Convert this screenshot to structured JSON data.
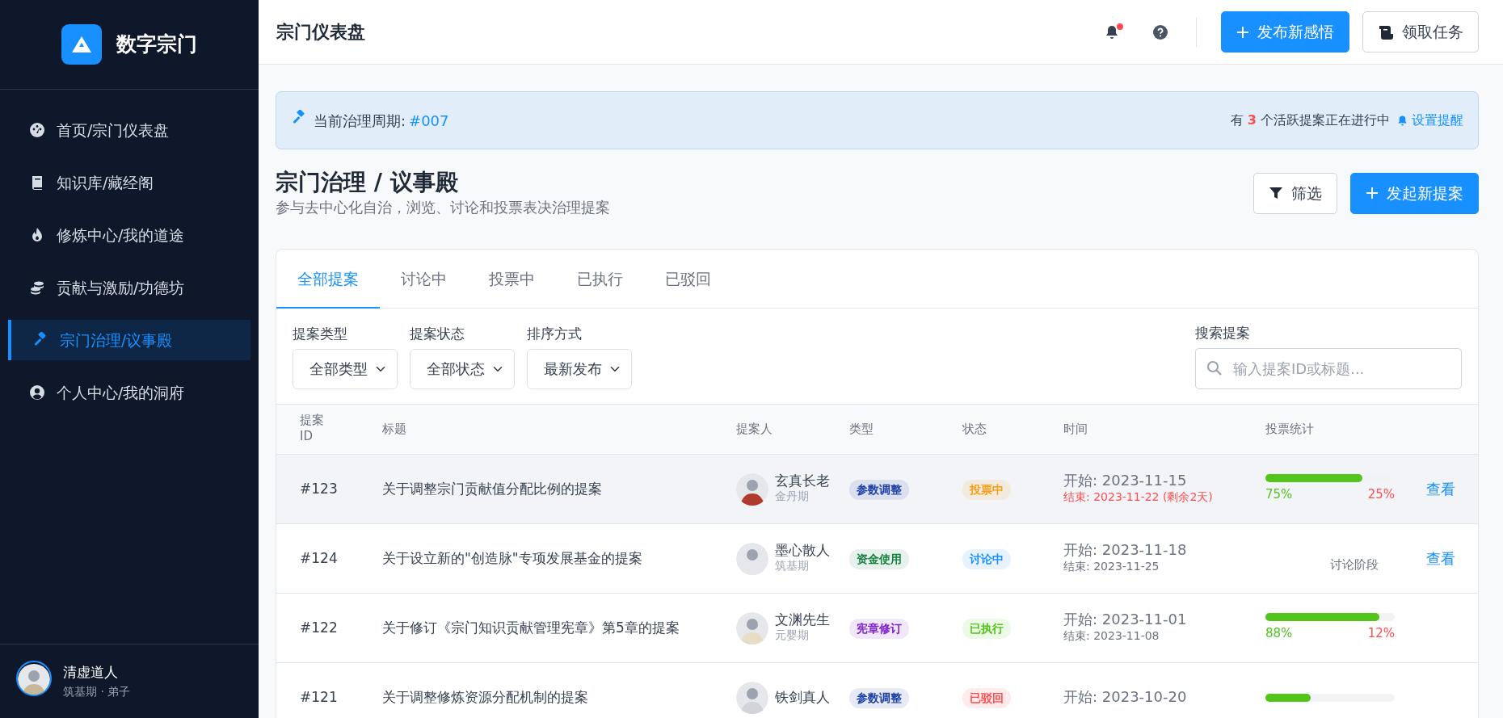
{
  "sidebar": {
    "brand": "数字宗门",
    "items": [
      {
        "label": "首页/宗门仪表盘",
        "selected": false
      },
      {
        "label": "知识库/藏经阁",
        "selected": false
      },
      {
        "label": "修炼中心/我的道途",
        "selected": false
      },
      {
        "label": "贡献与激励/功德坊",
        "selected": false
      },
      {
        "label": "宗门治理/议事殿",
        "selected": true
      },
      {
        "label": "个人中心/我的洞府",
        "selected": false
      }
    ],
    "user": {
      "name": "清虚道人",
      "subtitle": "筑基期 · 弟子"
    }
  },
  "header": {
    "title": "宗门仪表盘",
    "unread": true,
    "buttons": [
      {
        "kind": "primary",
        "label": "发布新感悟"
      },
      {
        "kind": "outline",
        "label": "领取任务"
      }
    ]
  },
  "banner": {
    "label": "当前治理周期:",
    "cycle": "#007",
    "prefix": "有",
    "count": "3",
    "suffix": "个活跃提案正在进行中",
    "link": "设置提醒"
  },
  "page": {
    "title": "宗门治理 / 议事殿",
    "subtitle": "参与去中心化自治，浏览、讨论和投票表决治理提案",
    "buttons": [
      {
        "kind": "filter",
        "label": "筛选"
      },
      {
        "kind": "primary",
        "label": "发起新提案"
      }
    ]
  },
  "tabs": [
    {
      "label": "全部提案",
      "selected": true
    },
    {
      "label": "讨论中",
      "selected": false
    },
    {
      "label": "投票中",
      "selected": false
    },
    {
      "label": "已执行",
      "selected": false
    },
    {
      "label": "已驳回",
      "selected": false
    }
  ],
  "filters": [
    {
      "label": "提案类型",
      "value": "全部类型"
    },
    {
      "label": "提案状态",
      "value": "全部状态"
    },
    {
      "label": "排序方式",
      "value": "最新发布"
    }
  ],
  "search": {
    "label": "搜索提案",
    "placeholder": "输入提案ID或标题..."
  },
  "table": {
    "columns": [
      "提案 ID",
      "标题",
      "提案人",
      "类型",
      "状态",
      "时间",
      "投票统计"
    ],
    "rows": [
      {
        "highlighted": true,
        "id": "#123",
        "title": "关于调整宗门贡献值分配比例的提案",
        "proposer": "玄真长老",
        "rank": "金丹期",
        "type": {
          "label": "参数调整",
          "color": "#1d3fa8"
        },
        "status": {
          "label": "投票中",
          "color": "#fa9d16"
        },
        "start": "开始: 2023-11-15",
        "end": "结束: 2023-11-22 (剩余2天)",
        "urgent": true,
        "votes": {
          "kind": "bar",
          "level": 0.75,
          "yes": "75%",
          "no": "25%"
        },
        "action": "查看"
      },
      {
        "highlighted": false,
        "id": "#124",
        "title": "关于设立新的\"创造脉\"专项发展基金的提案",
        "proposer": "墨心散人",
        "rank": "筑基期",
        "type": {
          "label": "资金使用",
          "color": "#15803d"
        },
        "status": {
          "label": "讨论中",
          "color": "#1890ff"
        },
        "start": "开始: 2023-11-18",
        "end": "结束: 2023-11-25",
        "urgent": false,
        "votes": {
          "kind": "text",
          "text": "讨论阶段"
        },
        "action": "查看"
      },
      {
        "highlighted": false,
        "id": "#122",
        "title": "关于修订《宗门知识贡献管理宪章》第5章的提案",
        "proposer": "文渊先生",
        "rank": "元婴期",
        "type": {
          "label": "宪章修订",
          "color": "#7e22ce"
        },
        "status": {
          "label": "已执行",
          "color": "#52c41a"
        },
        "start": "开始: 2023-11-01",
        "end": "结束: 2023-11-08",
        "votes": {
          "kind": "bar",
          "level": 0.88,
          "yes": "88%",
          "no": "12%"
        }
      },
      {
        "highlighted": false,
        "id": "#121",
        "title": "关于调整修炼资源分配机制的提案",
        "proposer": "铁剑真人",
        "type": {
          "label": "参数调整",
          "color": "#1d3fa8"
        },
        "status": {
          "label": "已驳回",
          "color": "#ff4d4f"
        },
        "start": "开始: 2023-10-20",
        "votes": {
          "kind": "bar",
          "level": 0.35
        }
      }
    ]
  }
}
